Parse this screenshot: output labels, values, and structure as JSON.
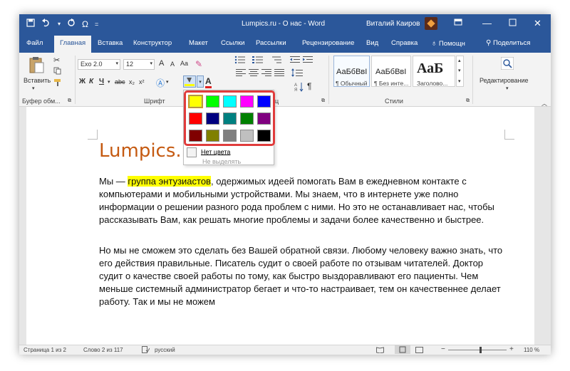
{
  "titlebar": {
    "quick_access": [
      "save-icon",
      "undo-icon",
      "redo-icon",
      "Ω",
      "customize-icon"
    ],
    "omega": "Ω",
    "title": "Lumpics.ru - О нас  -  Word",
    "user": "Виталий Каиров",
    "window_controls": [
      "ribbon-display-icon",
      "minimize-icon",
      "maximize-icon",
      "close-icon"
    ]
  },
  "tabs": {
    "file": "Файл",
    "home": "Главная",
    "insert": "Вставка",
    "design": "Конструктор",
    "layout": "Макет",
    "references": "Ссылки",
    "mailings": "Рассылки",
    "review": "Рецензирование",
    "view": "Вид",
    "help": "Справка",
    "tell_me": "Помощн",
    "share": "Поделиться"
  },
  "ribbon": {
    "clipboard": {
      "paste": "Вставить",
      "label": "Буфер обм..."
    },
    "font": {
      "font_name": "Exo 2.0",
      "font_size": "12",
      "bold": "Ж",
      "italic": "К",
      "underline": "Ч",
      "strikethrough": "abc",
      "subscript": "x₂",
      "superscript": "x²",
      "grow": "A",
      "shrink": "A",
      "case": "Aa",
      "label": "Шрифт"
    },
    "paragraph": {
      "label": "Абзац",
      "label_visible": "ац"
    },
    "styles": {
      "items": [
        {
          "sample": "АаБбВвI",
          "name": "¶ Обычный"
        },
        {
          "sample": "АаБбВвI",
          "name": "¶ Без инте..."
        },
        {
          "sample": "АаБ",
          "name": "Заголово..."
        }
      ],
      "label": "Стили"
    },
    "editing": {
      "label": "Редактирование"
    }
  },
  "highlight_dropdown": {
    "colors": [
      [
        "#ffff00",
        "#00ff00",
        "#00ffff",
        "#ff00ff",
        "#0000ff"
      ],
      [
        "#ff0000",
        "#000080",
        "#008080",
        "#008000",
        "#800080"
      ],
      [
        "#800000",
        "#808000",
        "#808080",
        "#c0c0c0",
        "#000000"
      ]
    ],
    "no_color": "Нет цвета",
    "stop_highlighting": "Не выделять",
    "accent": "#e03c3c"
  },
  "document": {
    "title": "Lumpics.ru - О нас",
    "p1_before": "Мы — ",
    "p1_highlight": "группа энтузиастов",
    "p1_after": ", одержимых идеей помогать Вам в ежедневном контакте с компьютерами и мобильными устройствами. Мы знаем, что в интернете уже полно информации о решении разного рода проблем с ними. Но это не останавливает нас, чтобы рассказывать Вам, как решать многие проблемы и задачи более качественно и быстрее.",
    "p2": "Но мы не сможем это сделать без Вашей обратной связи. Любому человеку важно знать, что его действия правильные. Писатель судит о своей работе по отзывам читателей. Доктор судит о качестве своей работы по тому, как быстро выздоравливают его пациенты. Чем меньше системный администратор бегает и что-то настраивает, тем он качественнее делает работу. Так и мы не можем",
    "highlight_color": "#ffff00",
    "title_color": "#c55a11"
  },
  "statusbar": {
    "page": "Страница 1 из 2",
    "words": "Слово 2 из 117",
    "language": "русский",
    "zoom_minus": "−",
    "zoom_plus": "+",
    "zoom": "110 %"
  },
  "colors": {
    "brand": "#2b579a"
  }
}
